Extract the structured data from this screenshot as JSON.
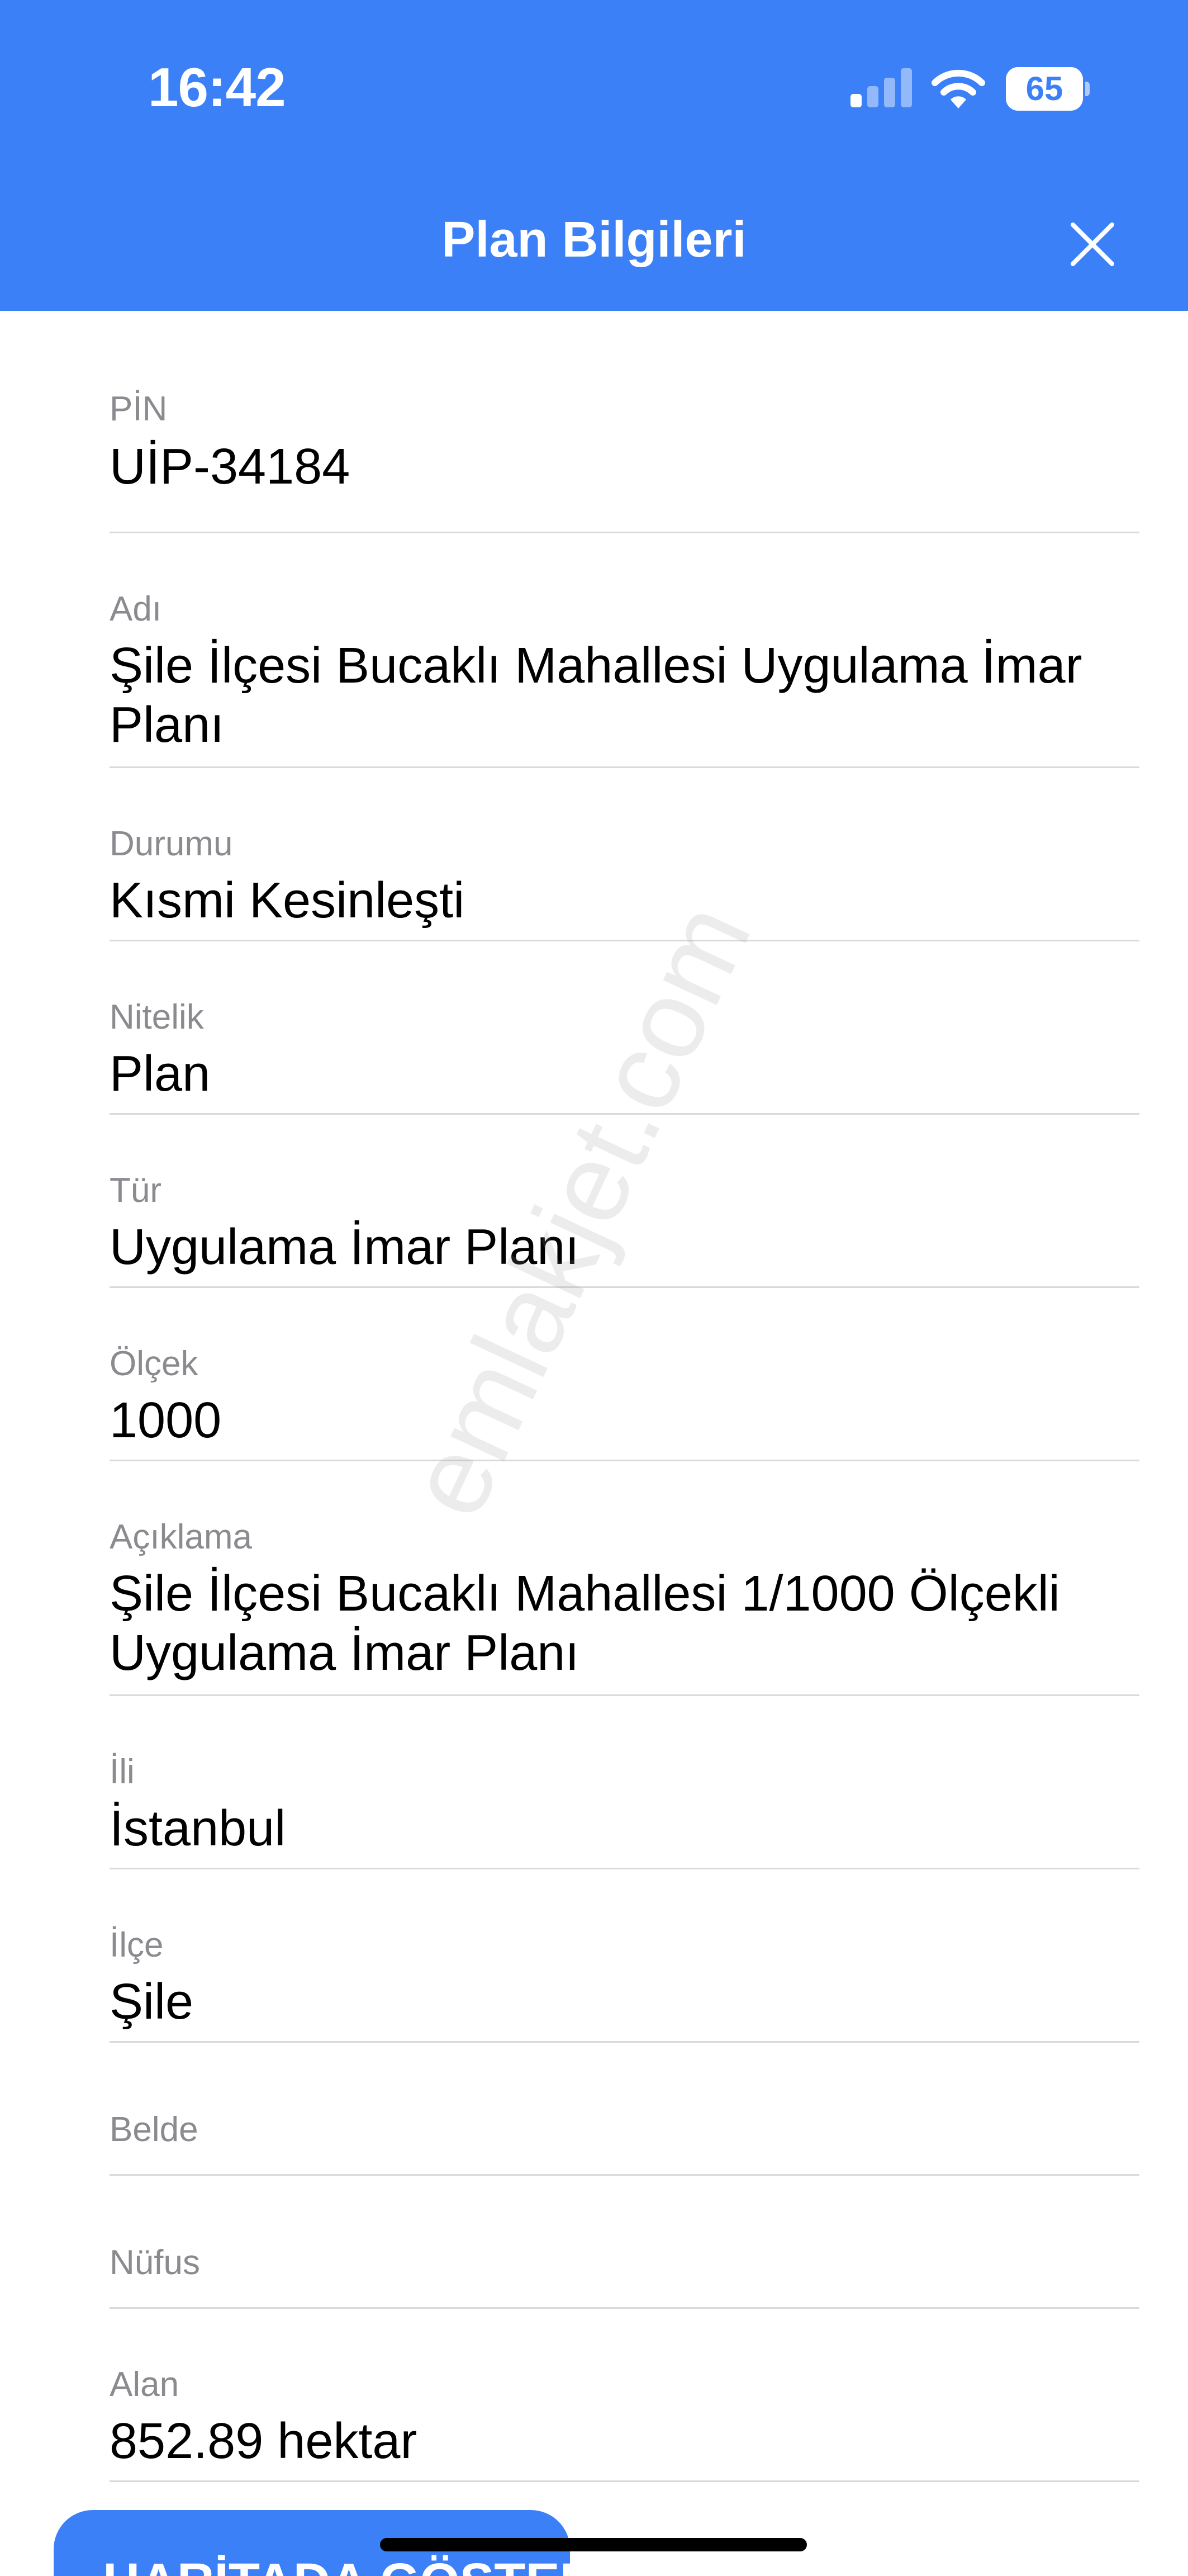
{
  "status_bar": {
    "time": "16:42",
    "battery_level": "65",
    "battery_fraction": 0.65,
    "icons": [
      "signal-icon",
      "wifi-icon",
      "battery-icon"
    ]
  },
  "nav": {
    "title": "Plan Bilgileri",
    "close_icon": "close-icon"
  },
  "fields": [
    {
      "label": "PİN",
      "value": "UİP-34184"
    },
    {
      "label": "Adı",
      "value": "Şile İlçesi Bucaklı Mahallesi Uygulama İmar Planı"
    },
    {
      "label": "Durumu",
      "value": "Kısmi Kesinleşti"
    },
    {
      "label": "Nitelik",
      "value": "Plan"
    },
    {
      "label": "Tür",
      "value": "Uygulama İmar Planı"
    },
    {
      "label": "Ölçek",
      "value": "1000"
    },
    {
      "label": "Açıklama",
      "value": "Şile İlçesi Bucaklı Mahallesi 1/1000 Ölçekli Uygulama İmar Planı"
    },
    {
      "label": "İli",
      "value": "İstanbul"
    },
    {
      "label": "İlçe",
      "value": "Şile"
    },
    {
      "label": "Belde",
      "value": ""
    },
    {
      "label": "Nüfus",
      "value": ""
    },
    {
      "label": "Alan",
      "value": "852.89 hektar"
    }
  ],
  "watermark": "emlakjet.com",
  "map_button": {
    "label": "HARİTADA GÖSTER"
  },
  "colors": {
    "accent": "#3B80F7",
    "label": "#8A8A8F",
    "separator": "#D9D9DE",
    "text": "#000000"
  }
}
